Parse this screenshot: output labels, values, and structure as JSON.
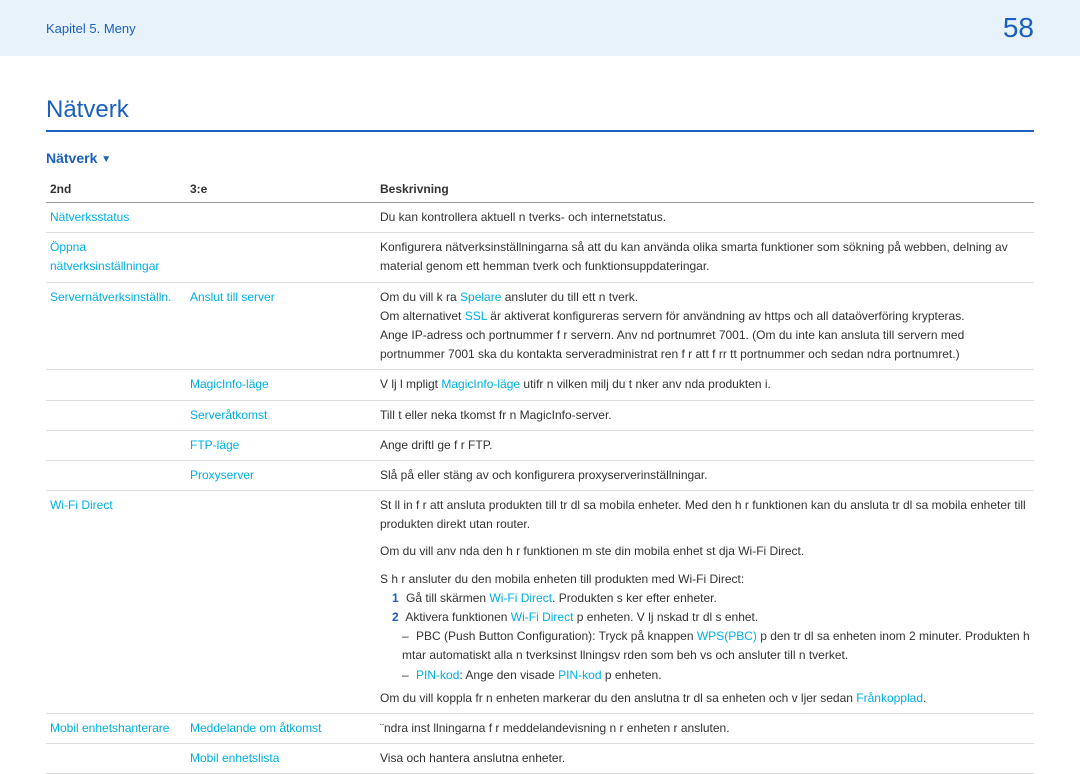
{
  "header": {
    "chapter": "Kapitel 5. Meny",
    "page": "58"
  },
  "title": "Nätverk",
  "section_label": "Nätverk",
  "columns": {
    "c1": "2nd",
    "c2": "3:e",
    "c3": "Beskrivning"
  },
  "rows": {
    "r1_c1": "Nätverksstatus",
    "r1_desc": "Du kan kontrollera aktuell n tverks- och internetstatus.",
    "r2_c1a": "Öppna",
    "r2_c1b": "nätverksinställningar",
    "r2_desc": "Konfigurera nätverksinställningarna så att du kan använda olika smarta funktioner som sökning på webben, delning av material genom ett hemman tverk och funktionsuppdateringar.",
    "r3_c1": "Servernätverksinställn.",
    "r3_c2": "Anslut till server",
    "r3_d1a": "Om du vill k ra ",
    "r3_d1_link": "Spelare",
    "r3_d1b": " ansluter du till ett n tverk.",
    "r3_d2a": "Om alternativet ",
    "r3_d2_link": "SSL",
    "r3_d2b": " är aktiverat konfigureras servern för användning av https och all dataöverföring krypteras.",
    "r3_d3": "Ange IP-adress och portnummer f r servern. Anv nd portnumret 7001. (Om du inte kan ansluta till servern med portnummer 7001 ska du kontakta serveradministrat ren f r att f rr tt portnummer och sedan  ndra portnumret.)",
    "r4_c2": "MagicInfo-läge",
    "r4_d_a": "V lj l mpligt ",
    "r4_d_link": "MagicInfo-läge",
    "r4_d_b": " utifr n vilken milj  du t nker anv nda produkten i.",
    "r5_c2": "Serveråtkomst",
    "r5_d": "Till t eller neka  tkomst fr n MagicInfo-server.",
    "r6_c2": "FTP-läge",
    "r6_d": "Ange driftl ge f r FTP.",
    "r7_c2": "Proxyserver",
    "r7_d": "Slå på eller stäng av och konfigurera proxyserverinställningar.",
    "r8_c1": "Wi-Fi Direct",
    "r8_d1": "St ll in f r att ansluta produkten till tr dl sa mobila enheter. Med den h r funktionen kan du ansluta tr dl sa mobila enheter till produkten direkt utan router.",
    "r8_d2": "Om du vill anv nda den h r funktionen m ste din mobila enhet st dja Wi-Fi Direct.",
    "r8_d3": "S h r ansluter du den mobila enheten till produkten med Wi-Fi Direct:",
    "r8_l1_n": "1",
    "r8_l1_a": "Gå till skärmen ",
    "r8_l1_link": "Wi-Fi Direct",
    "r8_l1_b": ". Produkten s ker efter enheter.",
    "r8_l2_n": "2",
    "r8_l2_a": "Aktivera funktionen ",
    "r8_l2_link": "Wi-Fi Direct",
    "r8_l2_b": " p  enheten. V lj  nskad tr dl s enhet.",
    "r8_s1_a": "PBC (Push Button Configuration): Tryck på knappen ",
    "r8_s1_link": "WPS(PBC)",
    "r8_s1_b": " p  den tr dl sa enheten inom 2 minuter. Produkten h mtar automatiskt alla n tverksinst llningsv rden som beh vs och ansluter till n tverket.",
    "r8_s2_link1": "PIN-kod",
    "r8_s2_a": ": Ange den visade ",
    "r8_s2_link2": "PIN-kod",
    "r8_s2_b": " p  enheten.",
    "r8_d4a": "Om du vill koppla fr n enheten markerar du den anslutna tr dl sa enheten och v ljer sedan ",
    "r8_d4_link": "Frånkopplad",
    "r8_d4b": ".",
    "r9_c1": "Mobil enhetshanterare",
    "r9_c2": "Meddelande om åtkomst",
    "r9_d": "¨ndra inst llningarna f r meddelandevisning n r enheten  r ansluten.",
    "r10_c2": "Mobil enhetslista",
    "r10_d": "Visa och hantera anslutna enheter."
  }
}
